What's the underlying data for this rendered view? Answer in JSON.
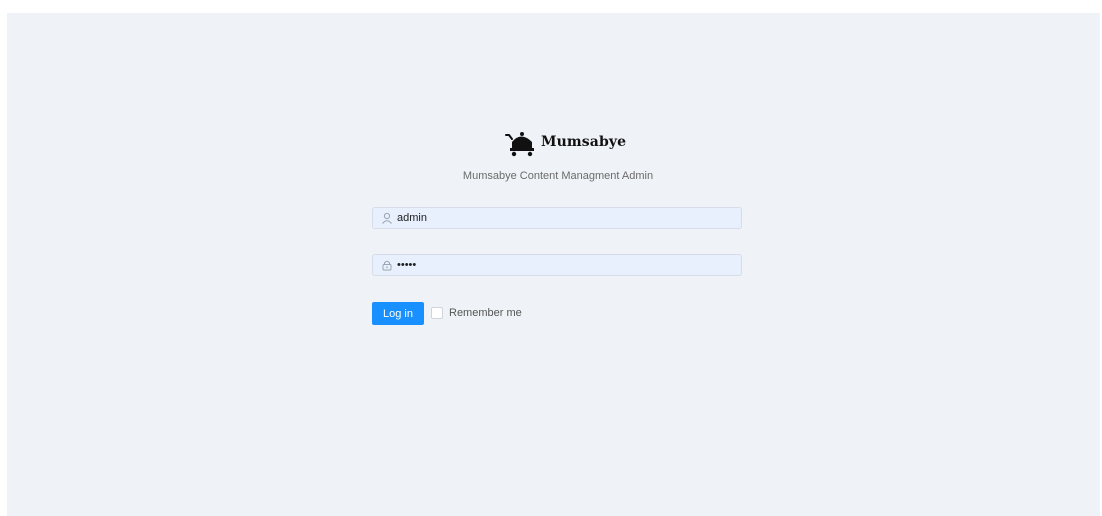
{
  "app": {
    "brand_name": "Mumsabye",
    "subtitle": "Mumsabye Content Managment Admin"
  },
  "login_form": {
    "username": {
      "value": "admin",
      "icon": "user-icon"
    },
    "password": {
      "value": "admin",
      "icon": "lock-icon"
    },
    "login_label": "Log in",
    "remember_label": "Remember me",
    "remember_checked": false
  },
  "colors": {
    "page_background": "#eff2f6",
    "input_background": "#e8f0fe",
    "primary_button": "#1890ff"
  }
}
